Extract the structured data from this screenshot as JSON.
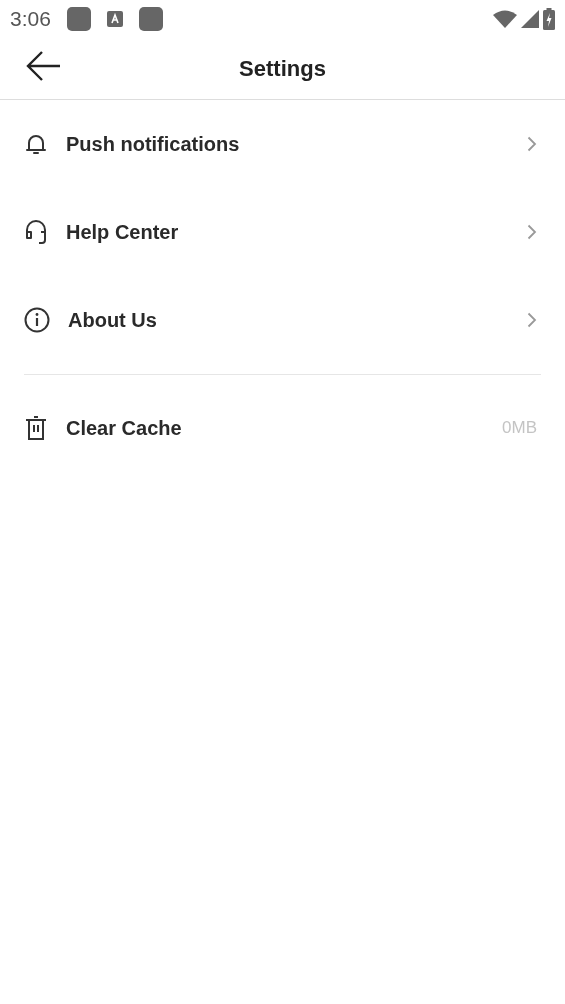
{
  "status_bar": {
    "time": "3:06"
  },
  "app_bar": {
    "title": "Settings"
  },
  "groups": [
    {
      "items": [
        {
          "label": "Push notifications",
          "kind": "link"
        },
        {
          "label": "Help Center",
          "kind": "link"
        },
        {
          "label": "About Us",
          "kind": "link"
        }
      ]
    },
    {
      "items": [
        {
          "label": "Clear Cache",
          "kind": "value",
          "value": "0MB"
        }
      ]
    }
  ]
}
